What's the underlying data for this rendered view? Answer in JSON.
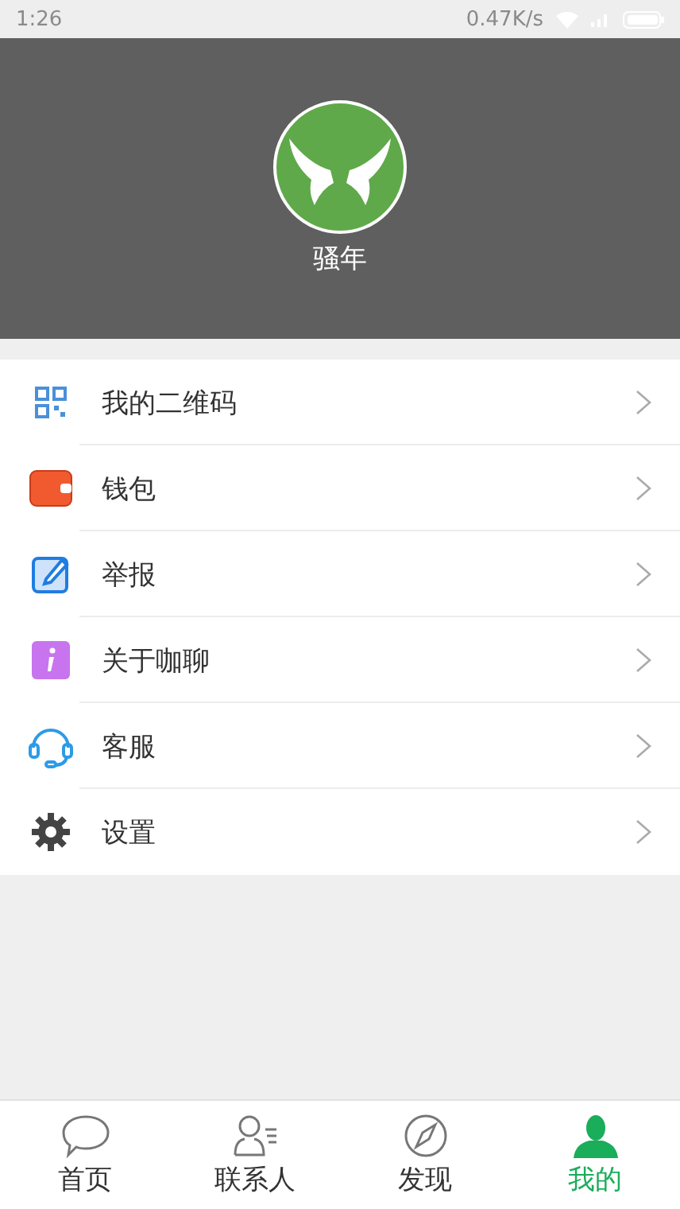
{
  "status_bar": {
    "time": "1:26",
    "speed": "0.47K/s"
  },
  "profile": {
    "name": "骚年"
  },
  "menu": [
    {
      "kind": "qrcode",
      "label": "我的二维码"
    },
    {
      "kind": "wallet",
      "label": "钱包"
    },
    {
      "kind": "report",
      "label": "举报"
    },
    {
      "kind": "info",
      "label": "关于咖聊"
    },
    {
      "kind": "service",
      "label": "客服"
    },
    {
      "kind": "settings",
      "label": "设置"
    }
  ],
  "tabs": [
    {
      "kind": "chat",
      "label": "首页",
      "selected": false
    },
    {
      "kind": "contacts",
      "label": "联系人",
      "selected": false
    },
    {
      "kind": "discover",
      "label": "发现",
      "selected": false
    },
    {
      "kind": "me",
      "label": "我的",
      "selected": true
    }
  ]
}
